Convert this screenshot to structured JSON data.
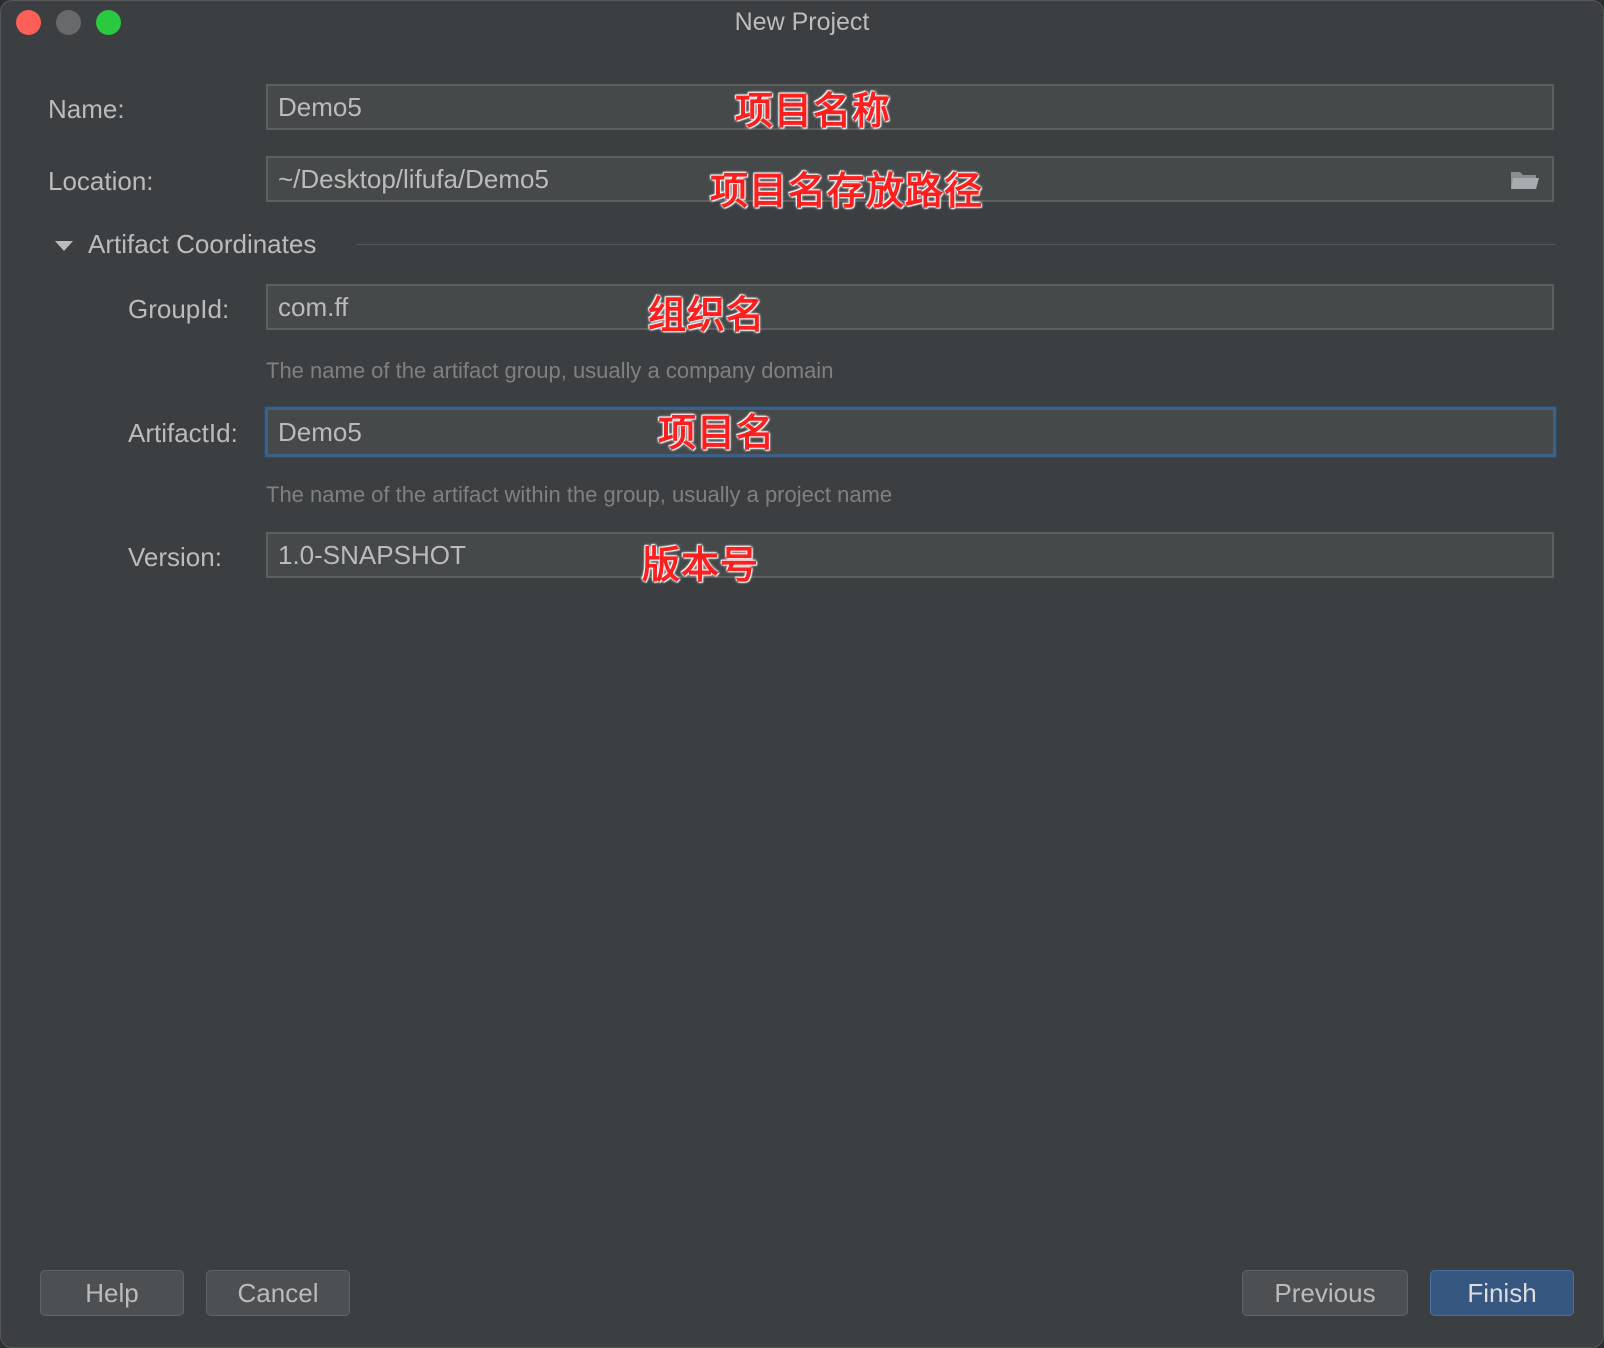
{
  "window": {
    "title": "New Project"
  },
  "form": {
    "name": {
      "label": "Name:",
      "value": "Demo5",
      "annotation": "项目名称"
    },
    "location": {
      "label": "Location:",
      "value": "~/Desktop/lifufa/Demo5",
      "annotation": "项目名存放路径",
      "icon": "folder-icon"
    },
    "artifact_section": {
      "title": "Artifact Coordinates",
      "expanded": true
    },
    "group_id": {
      "label": "GroupId:",
      "value": "com.ff",
      "annotation": "组织名",
      "hint": "The name of the artifact group, usually a company domain"
    },
    "artifact_id": {
      "label": "ArtifactId:",
      "value": "Demo5",
      "annotation": "项目名",
      "hint": "The name of the artifact within the group, usually a project name",
      "focused": true
    },
    "version": {
      "label": "Version:",
      "value": "1.0-SNAPSHOT",
      "annotation": "版本号"
    }
  },
  "buttons": {
    "help": "Help",
    "cancel": "Cancel",
    "previous": "Previous",
    "finish": "Finish"
  },
  "colors": {
    "background": "#3c3f41",
    "field_bg": "#45494a",
    "focus_border": "#3d6185",
    "annotation": "#ff1f1f",
    "primary_button": "#365880",
    "close": "#fe5f57",
    "minimize": "#68696b",
    "maximize": "#2ac93f"
  }
}
